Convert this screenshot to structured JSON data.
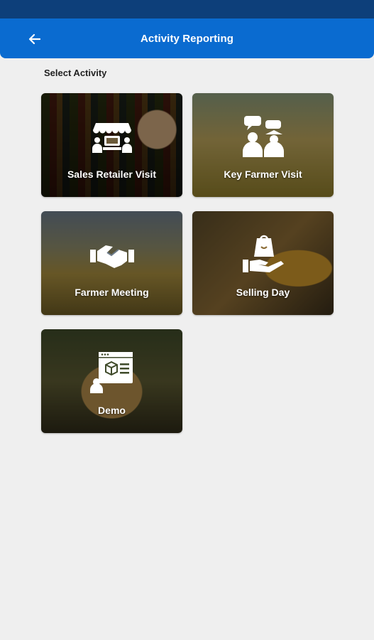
{
  "header": {
    "title": "Activity Reporting",
    "back_icon": "arrow-left-icon",
    "color": "#0a6bd0",
    "status_bar_color": "#0d3f7a"
  },
  "section": {
    "label": "Select Activity"
  },
  "tiles": [
    {
      "label": "Sales Retailer Visit",
      "icon": "storefront-icon"
    },
    {
      "label": "Key Farmer Visit",
      "icon": "people-chat-icon"
    },
    {
      "label": "Farmer Meeting",
      "icon": "handshake-icon"
    },
    {
      "label": "Selling Day",
      "icon": "shopping-bag-hand-icon"
    },
    {
      "label": "Demo",
      "icon": "product-demo-icon"
    }
  ]
}
